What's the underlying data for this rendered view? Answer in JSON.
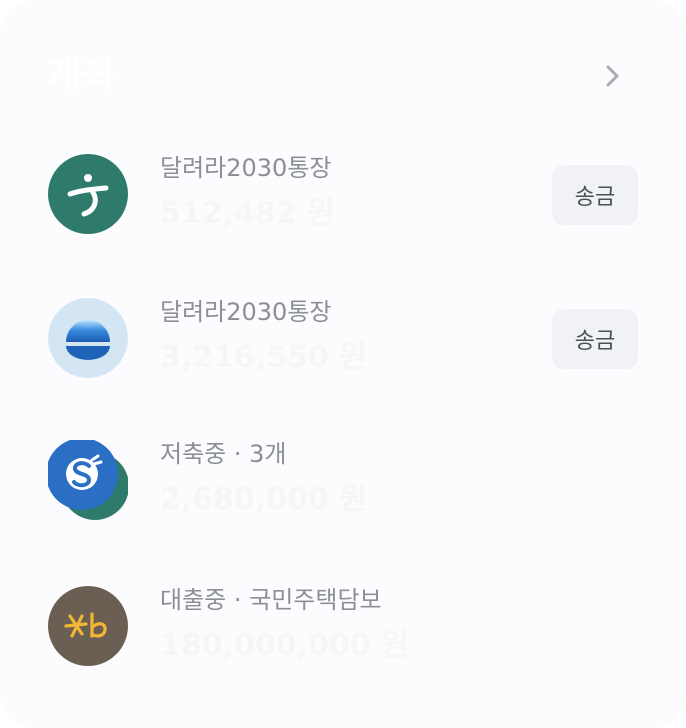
{
  "header": {
    "title": "계좌"
  },
  "accounts": [
    {
      "name": "달려라2030통장",
      "balance": "512,482 원",
      "action_label": "송금",
      "icon": "hana-bank-logo"
    },
    {
      "name": "달려라2030통장",
      "balance": "3,216,550 원",
      "action_label": "송금",
      "icon": "woori-bank-logo"
    },
    {
      "name": "저축중 · 3개",
      "balance": "2,680,000 원",
      "icon": "shinhan-bank-logo"
    },
    {
      "name": "대출중 · 국민주택담보",
      "balance": "180,000,000 원",
      "icon": "kb-bank-logo"
    }
  ],
  "colors": {
    "hana_green": "#2f7b6b",
    "woori_blue": "#2a80d0",
    "shinhan_blue": "#2b6fc4",
    "kb_brown": "#6a5f52",
    "kb_yellow": "#f2b632",
    "button_bg": "#f1f2f5",
    "label_gray": "#8a8f98"
  }
}
